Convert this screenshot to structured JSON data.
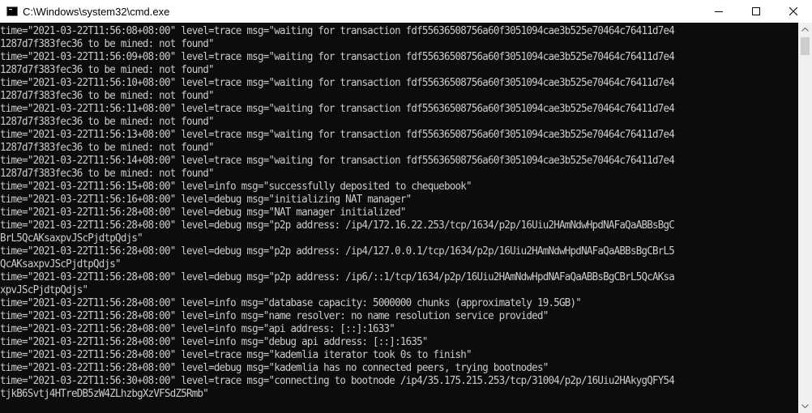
{
  "window": {
    "title": "C:\\Windows\\system32\\cmd.exe",
    "icon": "console-icon"
  },
  "caption_buttons": [
    "minimize-icon",
    "maximize-icon",
    "close-icon"
  ],
  "console": {
    "lines": [
      "time=\"2021-03-22T11:56:08+08:00\" level=trace msg=\"waiting for transaction fdf55636508756a60f3051094cae3b525e70464c76411d7e4",
      "1287d7f383fec36 to be mined: not found\"",
      "time=\"2021-03-22T11:56:09+08:00\" level=trace msg=\"waiting for transaction fdf55636508756a60f3051094cae3b525e70464c76411d7e4",
      "1287d7f383fec36 to be mined: not found\"",
      "time=\"2021-03-22T11:56:10+08:00\" level=trace msg=\"waiting for transaction fdf55636508756a60f3051094cae3b525e70464c76411d7e4",
      "1287d7f383fec36 to be mined: not found\"",
      "time=\"2021-03-22T11:56:11+08:00\" level=trace msg=\"waiting for transaction fdf55636508756a60f3051094cae3b525e70464c76411d7e4",
      "1287d7f383fec36 to be mined: not found\"",
      "time=\"2021-03-22T11:56:13+08:00\" level=trace msg=\"waiting for transaction fdf55636508756a60f3051094cae3b525e70464c76411d7e4",
      "1287d7f383fec36 to be mined: not found\"",
      "time=\"2021-03-22T11:56:14+08:00\" level=trace msg=\"waiting for transaction fdf55636508756a60f3051094cae3b525e70464c76411d7e4",
      "1287d7f383fec36 to be mined: not found\"",
      "time=\"2021-03-22T11:56:15+08:00\" level=info msg=\"successfully deposited to chequebook\"",
      "time=\"2021-03-22T11:56:16+08:00\" level=debug msg=\"initializing NAT manager\"",
      "time=\"2021-03-22T11:56:28+08:00\" level=debug msg=\"NAT manager initialized\"",
      "time=\"2021-03-22T11:56:28+08:00\" level=debug msg=\"p2p address: /ip4/172.16.22.253/tcp/1634/p2p/16Uiu2HAmNdwHpdNAFaQaABBsBgC",
      "BrL5QcAKsaxpvJScPjdtpQdjs\"",
      "time=\"2021-03-22T11:56:28+08:00\" level=debug msg=\"p2p address: /ip4/127.0.0.1/tcp/1634/p2p/16Uiu2HAmNdwHpdNAFaQaABBsBgCBrL5",
      "QcAKsaxpvJScPjdtpQdjs\"",
      "time=\"2021-03-22T11:56:28+08:00\" level=debug msg=\"p2p address: /ip6/::1/tcp/1634/p2p/16Uiu2HAmNdwHpdNAFaQaABBsBgCBrL5QcAKsa",
      "xpvJScPjdtpQdjs\"",
      "time=\"2021-03-22T11:56:28+08:00\" level=info msg=\"database capacity: 5000000 chunks (approximately 19.5GB)\"",
      "time=\"2021-03-22T11:56:28+08:00\" level=info msg=\"name resolver: no name resolution service provided\"",
      "time=\"2021-03-22T11:56:28+08:00\" level=info msg=\"api address: [::]:1633\"",
      "time=\"2021-03-22T11:56:28+08:00\" level=info msg=\"debug api address: [::]:1635\"",
      "time=\"2021-03-22T11:56:28+08:00\" level=trace msg=\"kademlia iterator took 0s to finish\"",
      "time=\"2021-03-22T11:56:28+08:00\" level=debug msg=\"kademlia has no connected peers, trying bootnodes\"",
      "time=\"2021-03-22T11:56:30+08:00\" level=trace msg=\"connecting to bootnode /ip4/35.175.215.253/tcp/31004/p2p/16Uiu2HAkygQFY54",
      "tjkB6Svtj4HTreDB5zW4ZLhzbgXzVFSdZ5Rmb\""
    ]
  },
  "scrollbar": {
    "up_icon": "scroll-up-arrow-icon",
    "down_icon": "scroll-down-arrow-icon"
  },
  "colors": {
    "console_bg": "#0c0c0c",
    "console_text": "#cccccc",
    "titlebar_bg": "#ffffff"
  }
}
